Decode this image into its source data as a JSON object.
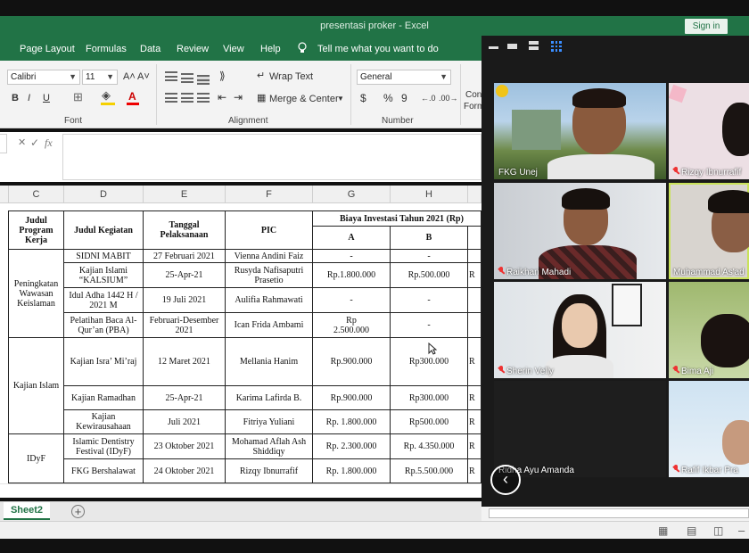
{
  "window": {
    "title": "presentasi proker  -  Excel",
    "signin_label": "Sign in"
  },
  "menu": {
    "tabs": [
      "Page Layout",
      "Formulas",
      "Data",
      "Review",
      "View",
      "Help"
    ],
    "tell_me": "Tell me what you want to do"
  },
  "ribbon": {
    "font_name": "Calibri",
    "font_size": "11",
    "grow_font": "A˄",
    "shrink_font": "A˅",
    "bold": "B",
    "italic": "I",
    "underline": "U",
    "wrap_text": "Wrap Text",
    "merge_center": "Merge & Center",
    "number_format": "General",
    "currency": "$",
    "percent": "%",
    "comma": "9",
    "cond_format_partial": [
      "Con",
      "Form"
    ],
    "groups": {
      "font": "Font",
      "alignment": "Alignment",
      "number": "Number"
    }
  },
  "formula_bar": {
    "fx": "fx",
    "check": "✓",
    "cancel": "✕",
    "value": ""
  },
  "columns": [
    "C",
    "D",
    "E",
    "F",
    "G",
    "H"
  ],
  "table": {
    "headers": {
      "program": "Judul Program Kerja",
      "kegiatan": "Judul Kegiatan",
      "tanggal": "Tanggal Pelaksanaan",
      "pic": "PIC",
      "biaya": "Biaya Investasi Tahun 2021 (Rp)",
      "col_a": "A",
      "col_b": "B"
    },
    "programs": [
      "Peningkatan Wawasan Keislaman",
      "Kajian Islam",
      "IDyF"
    ],
    "rows": [
      {
        "kegiatan": "SIDNI MABIT",
        "tanggal": "27 Februari 2021",
        "pic": "Vienna Andini Faiz",
        "a": "-",
        "b": "-"
      },
      {
        "kegiatan": "Kajian Islami “KALSIUM”",
        "tanggal": "25-Apr-21",
        "pic": "Rusyda Nafisaputri Prasetio",
        "a": "Rp.1.800.000",
        "b": "Rp.500.000"
      },
      {
        "kegiatan": "Idul Adha 1442 H / 2021 M",
        "tanggal": "19 Juli 2021",
        "pic": "Aulifia Rahmawati",
        "a": "-",
        "b": "-"
      },
      {
        "kegiatan": "Pelatihan Baca Al-Qur’an (PBA)",
        "tanggal": "Februari-Desember 2021",
        "pic": "Ican Frida Ambami",
        "a": "Rp 2.500.000",
        "b": "-"
      },
      {
        "kegiatan": "Kajian Isra’ Mi’raj",
        "tanggal": "12 Maret 2021",
        "pic": "Mellania Hanim",
        "a": "Rp.900.000",
        "b": "Rp300.000"
      },
      {
        "kegiatan": "Kajian Ramadhan",
        "tanggal": "25-Apr-21",
        "pic": "Karima Lafirda B.",
        "a": "Rp.900.000",
        "b": "Rp300.000"
      },
      {
        "kegiatan": "Kajian Kewirausahaan",
        "tanggal": "Juli 2021",
        "pic": "Fitriya Yuliani",
        "a": "Rp. 1.800.000",
        "b": "Rp500.000"
      },
      {
        "kegiatan": "Islamic Dentistry Festival (IDyF)",
        "tanggal": "23 Oktober 2021",
        "pic": "Mohamad Aflah Ash Shiddiqy",
        "a": "Rp. 2.300.000",
        "b": "Rp. 4.350.000"
      },
      {
        "kegiatan": "FKG Bershalawat",
        "tanggal": "24 Oktober 2021",
        "pic": "Rizqy Ibnurrafif",
        "a": "Rp. 1.800.000",
        "b": "Rp.5.500.000"
      }
    ],
    "col_i_partial": [
      "R",
      "R",
      "R",
      "R",
      "R",
      "R"
    ]
  },
  "sheets": {
    "active": "Sheet2",
    "add": "+"
  },
  "meeting": {
    "back_icon": "‹",
    "participants": [
      {
        "name": "FKG Unej",
        "muted": false
      },
      {
        "name": "Rizqy Ibnurrafif",
        "muted": true
      },
      {
        "name": "Raikhan Mahadi",
        "muted": true
      },
      {
        "name": "Muhammad As'ad",
        "muted": false
      },
      {
        "name": "Sherin Velly",
        "muted": true
      },
      {
        "name": "Bima Aji",
        "muted": true
      },
      {
        "name": "Ridha Ayu Amanda",
        "muted": false
      },
      {
        "name": "Rafif Ikbar Pra",
        "muted": true
      }
    ]
  },
  "colors": {
    "excel_green": "#217346",
    "speaker_highlight": "#c9e25a",
    "mute_red": "#e33333"
  }
}
